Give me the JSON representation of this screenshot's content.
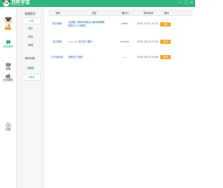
{
  "app": {
    "brand": "刘咚学堂",
    "brand_sub": "liudong.com",
    "window_controls": [
      "—",
      "□",
      "✕"
    ]
  },
  "user": {
    "name": "小鹿"
  },
  "leftnav": [
    {
      "label": "答疑课堂",
      "icon": "chat-icon",
      "active": true
    },
    {
      "label": "直播",
      "icon": "tv-icon",
      "active": false
    },
    {
      "label": "在线课堂",
      "icon": "cloud-icon",
      "active": false
    },
    {
      "label": "设置",
      "icon": "gear-icon",
      "active": false
    }
  ],
  "subnav": {
    "title": "答疑提问",
    "items": [
      {
        "label": "全部",
        "selected": true
      },
      {
        "label": "语文",
        "selected": false
      },
      {
        "label": "英语",
        "selected": false
      },
      {
        "label": "物理",
        "selected": false
      }
    ],
    "section": "提问列表",
    "filters": [
      {
        "label": "未解答",
        "selected": false
      },
      {
        "label": "已解答",
        "selected": true
      }
    ]
  },
  "table": {
    "headers": [
      "学科",
      "内容",
      "提问人",
      "提问时间",
      "操作"
    ],
    "rows": [
      {
        "subject": "语文课程",
        "content_lines": [
          "这道题 长篇阅读题目以篇阅读理解",
          "题是什么?请解答"
        ],
        "content_faded": "",
        "asker": "pfifer",
        "time": "2015-10-01 14:12",
        "action": "查看"
      },
      {
        "subject": "语文课程",
        "content_lines": [
          "请问这个题目"
        ],
        "content_faded": "Sungl@",
        "asker": "Sunlike",
        "time": "2015-09-23 07:00",
        "action": "查看"
      },
      {
        "subject": "五年级英语",
        "content_lines": [
          "请解答下道题"
        ],
        "content_faded": "",
        "asker": "------",
        "time": "2015-09-23 03:00",
        "action": "查看"
      }
    ]
  },
  "colors": {
    "brand": "#2fb67a",
    "action": "#f5a22a",
    "link": "#2a6ec3"
  }
}
